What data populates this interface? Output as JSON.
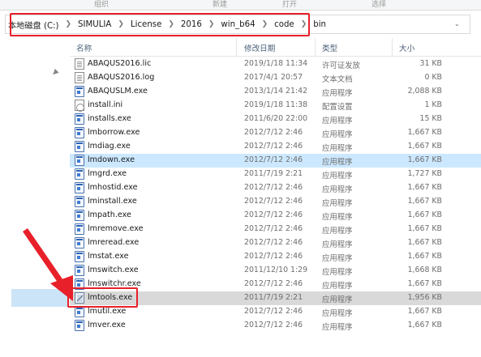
{
  "ribbon": {
    "groups": [
      "组织",
      "新建",
      "打开",
      "选择"
    ]
  },
  "address": {
    "crumbs": [
      "本地磁盘 (C:)",
      "SIMULIA",
      "License",
      "2016",
      "win_b64",
      "code",
      "bin"
    ]
  },
  "columns": {
    "name": "名称",
    "date": "修改日期",
    "type": "类型",
    "size": "大小"
  },
  "files": [
    {
      "name": "ABAQUS2016.lic",
      "date": "2019/1/18 11:34",
      "type": "许可证发放",
      "size": "31 KB",
      "icon": "license-file-icon"
    },
    {
      "name": "ABAQUS2016.log",
      "date": "2017/4/1 20:57",
      "type": "文本文档",
      "size": "0 KB",
      "icon": "text-document-icon"
    },
    {
      "name": "ABAQUSLM.exe",
      "date": "2013/1/14 21:42",
      "type": "应用程序",
      "size": "2,088 KB",
      "icon": "application-icon"
    },
    {
      "name": "install.ini",
      "date": "2019/1/18 11:38",
      "type": "配置设置",
      "size": "1 KB",
      "icon": "config-settings-icon"
    },
    {
      "name": "installs.exe",
      "date": "2011/6/20 22:00",
      "type": "应用程序",
      "size": "15 KB",
      "icon": "application-icon"
    },
    {
      "name": "lmborrow.exe",
      "date": "2012/7/12 2:46",
      "type": "应用程序",
      "size": "1,667 KB",
      "icon": "application-icon"
    },
    {
      "name": "lmdiag.exe",
      "date": "2012/7/12 2:46",
      "type": "应用程序",
      "size": "1,667 KB",
      "icon": "application-icon"
    },
    {
      "name": "lmdown.exe",
      "date": "2012/7/12 2:46",
      "type": "应用程序",
      "size": "1,667 KB",
      "icon": "application-icon"
    },
    {
      "name": "lmgrd.exe",
      "date": "2011/7/19 2:21",
      "type": "应用程序",
      "size": "1,727 KB",
      "icon": "application-icon"
    },
    {
      "name": "lmhostid.exe",
      "date": "2012/7/12 2:46",
      "type": "应用程序",
      "size": "1,667 KB",
      "icon": "application-icon"
    },
    {
      "name": "lminstall.exe",
      "date": "2012/7/12 2:46",
      "type": "应用程序",
      "size": "1,667 KB",
      "icon": "application-icon"
    },
    {
      "name": "lmpath.exe",
      "date": "2012/7/12 2:46",
      "type": "应用程序",
      "size": "1,667 KB",
      "icon": "application-icon"
    },
    {
      "name": "lmremove.exe",
      "date": "2012/7/12 2:46",
      "type": "应用程序",
      "size": "1,667 KB",
      "icon": "application-icon"
    },
    {
      "name": "lmreread.exe",
      "date": "2012/7/12 2:46",
      "type": "应用程序",
      "size": "1,667 KB",
      "icon": "application-icon"
    },
    {
      "name": "lmstat.exe",
      "date": "2012/7/12 2:46",
      "type": "应用程序",
      "size": "1,667 KB",
      "icon": "application-icon"
    },
    {
      "name": "lmswitch.exe",
      "date": "2011/12/10 1:29",
      "type": "应用程序",
      "size": "1,668 KB",
      "icon": "application-icon"
    },
    {
      "name": "lmswitchr.exe",
      "date": "2012/7/12 2:46",
      "type": "应用程序",
      "size": "1,667 KB",
      "icon": "application-icon"
    },
    {
      "name": "lmtools.exe",
      "date": "2011/7/19 2:21",
      "type": "应用程序",
      "size": "1,956 KB",
      "icon": "lmtools-app-icon"
    },
    {
      "name": "lmutil.exe",
      "date": "2012/7/12 2:46",
      "type": "应用程序",
      "size": "1,667 KB",
      "icon": "application-icon"
    },
    {
      "name": "lmver.exe",
      "date": "2012/7/12 2:46",
      "type": "应用程序",
      "size": "1,667 KB",
      "icon": "application-icon"
    }
  ],
  "highlight_color": "#e8202a"
}
